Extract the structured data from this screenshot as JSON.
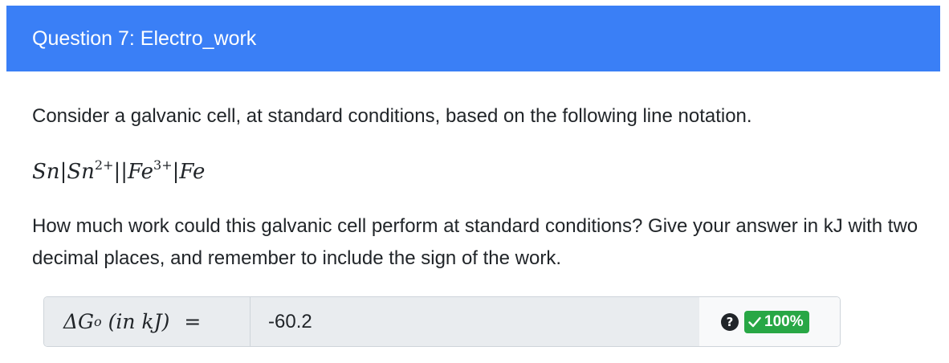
{
  "header": {
    "title": "Question 7: Electro_work"
  },
  "question": {
    "intro": "Consider a galvanic cell, at standard conditions, based on the following line notation.",
    "notation": {
      "anode": "Sn",
      "anode_ion": "Sn",
      "anode_ion_charge": "2+",
      "cathode_ion": "Fe",
      "cathode_ion_charge": "3+",
      "cathode": "Fe"
    },
    "prompt": "How much work could this galvanic cell perform at standard conditions? Give your answer in kJ with two decimal places, and remember to include the sign of the work."
  },
  "answer": {
    "label_symbol": "ΔG",
    "label_superscript": "o",
    "label_unit": "(in kJ)",
    "label_equals": "=",
    "value": "-60.2",
    "help_icon": "question-circle-icon",
    "score": "100%",
    "score_color": "#28a745",
    "check_icon": "check-icon"
  },
  "colors": {
    "header_bg": "#3a7ff6",
    "header_text": "#ffffff"
  }
}
